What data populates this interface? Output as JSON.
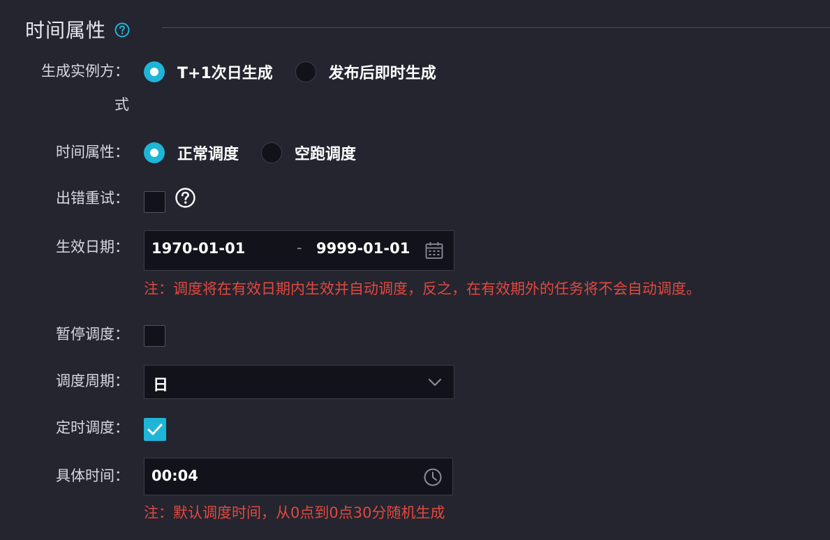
{
  "section": {
    "title": "时间属性"
  },
  "instance_mode": {
    "label_line1": "生成实例方：",
    "label_line2": "式",
    "options": [
      "T+1次日生成",
      "发布后即时生成"
    ],
    "selected": 0
  },
  "time_property": {
    "label": "时间属性：",
    "options": [
      "正常调度",
      "空跑调度"
    ],
    "selected": 0
  },
  "retry_on_error": {
    "label": "出错重试：",
    "checked": false
  },
  "effective_date": {
    "label": "生效日期：",
    "start": "1970-01-01",
    "separator": "-",
    "end": "9999-01-01",
    "note": "注：调度将在有效日期内生效并自动调度，反之，在有效期外的任务将不会自动调度。"
  },
  "pause_schedule": {
    "label": "暂停调度：",
    "checked": false
  },
  "schedule_cycle": {
    "label": "调度周期：",
    "value": "日"
  },
  "timed_schedule": {
    "label": "定时调度：",
    "checked": true
  },
  "specific_time": {
    "label": "具体时间：",
    "value": "00:04",
    "note": "注：默认调度时间，从0点到0点30分随机生成"
  },
  "colors": {
    "accent": "#1eb5d8",
    "warning": "#e2483f",
    "background": "#24252f"
  }
}
